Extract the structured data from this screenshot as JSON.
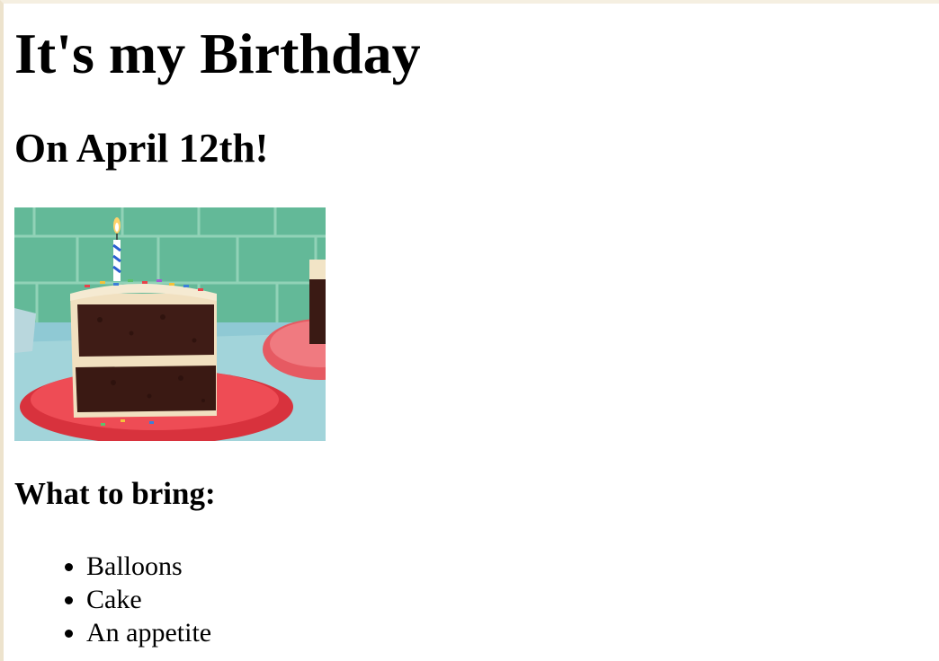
{
  "heading": "It's my Birthday",
  "subheading": "On April 12th!",
  "image": {
    "subject": "slice of chocolate layer cake with sprinkles and candle on a red plate",
    "colors": {
      "tile": "#5fb896",
      "plate": "#e8424a",
      "cake": "#3a1a14",
      "frosting": "#f1e2c6"
    }
  },
  "bring_heading": "What to bring:",
  "bring_items": [
    "Balloons",
    "Cake",
    "An appetite"
  ]
}
